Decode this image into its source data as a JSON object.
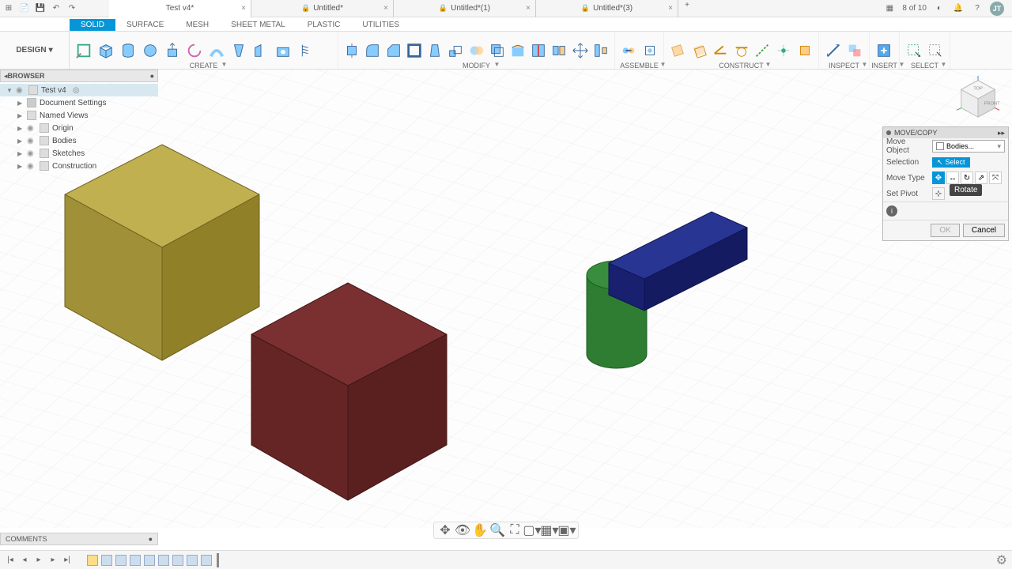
{
  "sysbar": {
    "tabs": [
      {
        "label": "Test v4*",
        "active": true,
        "locked": false
      },
      {
        "label": "Untitled*",
        "active": false,
        "locked": true
      },
      {
        "label": "Untitled*(1)",
        "active": false,
        "locked": true
      },
      {
        "label": "Untitled*(3)",
        "active": false,
        "locked": true
      }
    ],
    "job_status": "8 of 10",
    "avatar": "JT"
  },
  "workspace": "DESIGN",
  "ribbon_tabs": [
    "SOLID",
    "SURFACE",
    "MESH",
    "SHEET METAL",
    "PLASTIC",
    "UTILITIES"
  ],
  "tool_groups": [
    "CREATE",
    "MODIFY",
    "ASSEMBLE",
    "CONSTRUCT",
    "INSPECT",
    "INSERT",
    "SELECT"
  ],
  "browser": {
    "title": "BROWSER",
    "root": "Test v4",
    "items": [
      "Document Settings",
      "Named Views",
      "Origin",
      "Bodies",
      "Sketches",
      "Construction"
    ]
  },
  "comments": "COMMENTS",
  "panel": {
    "title": "MOVE/COPY",
    "rows": {
      "move_object": {
        "label": "Move Object",
        "value": "Bodies..."
      },
      "selection": {
        "label": "Selection",
        "button": "Select"
      },
      "move_type": {
        "label": "Move Type"
      },
      "set_pivot": {
        "label": "Set Pivot"
      }
    },
    "tooltip": "Rotate",
    "ok": "OK",
    "cancel": "Cancel"
  }
}
